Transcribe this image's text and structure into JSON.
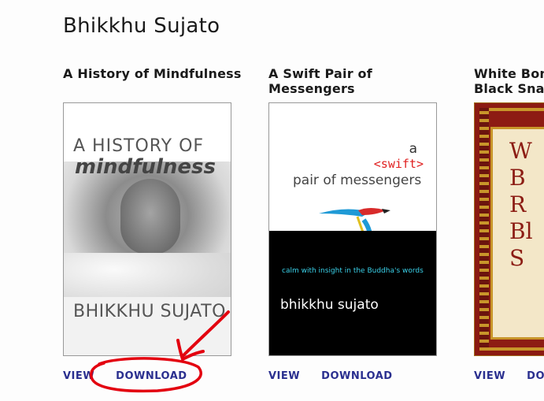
{
  "author": "Bhikkhu Sujato",
  "books": [
    {
      "title": "A History of Mindfulness",
      "cover": {
        "line1": "A HISTORY OF",
        "line2": "mindfulness",
        "author": "BHIKKHU SUJATO"
      },
      "view_label": "VIEW",
      "download_label": "DOWNLOAD"
    },
    {
      "title": "A Swift Pair of Messengers",
      "cover": {
        "line1": "a",
        "line2": "<swift>",
        "line3": "pair of messengers",
        "tagline": "calm with insight in the Buddha's words",
        "author": "bhikkhu sujato"
      },
      "view_label": "VIEW",
      "download_label": "DOWNLOAD"
    },
    {
      "title": "White Bones Red Rot Black Snakes",
      "title_visible": "White Bon\nBlack Snak",
      "cover": {
        "letters": "W\nB\nR\nBl\nSn"
      },
      "view_label": "VIEW",
      "download_label": "DOW"
    }
  ],
  "annotation": {
    "color": "#e3000f",
    "type": "hand-drawn circle and arrow around DOWNLOAD"
  },
  "colors": {
    "link": "#2a2f8f",
    "text": "#1a1a1a"
  }
}
